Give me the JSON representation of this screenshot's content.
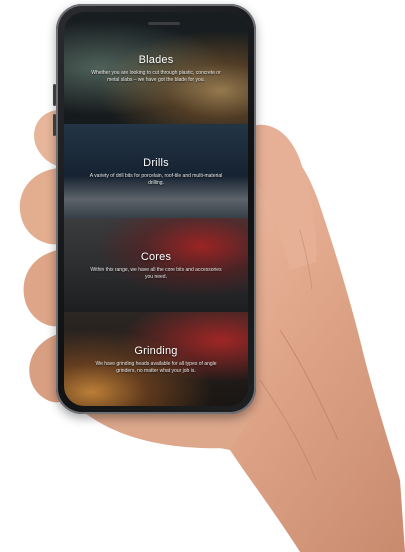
{
  "sections": [
    {
      "title": "Blades",
      "description": "Whether you are looking to cut through plastic, concrete or metal slabs – we have got the blade for you."
    },
    {
      "title": "Drills",
      "description": "A variety of drill bits for porcelain, roof-tile and multi-material drilling."
    },
    {
      "title": "Cores",
      "description": "Within this range, we have all the core bits and accessories you need."
    },
    {
      "title": "Grinding",
      "description": "We have grinding heads available for all types of angle grinders, no matter what your job is."
    }
  ]
}
